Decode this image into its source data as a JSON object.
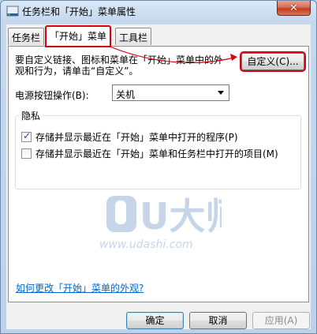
{
  "window": {
    "title": "任务栏和「开始」菜单属性",
    "close_glyph": "✕"
  },
  "tabs": [
    {
      "label": "任务栏",
      "active": false
    },
    {
      "label": "「开始」菜单",
      "active": true
    },
    {
      "label": "工具栏",
      "active": false
    }
  ],
  "start_menu": {
    "description": "要自定义链接、图标和菜单在「开始」菜单中的外观和行为，请单击“自定义”。",
    "customize_button": "自定义(C)...",
    "power_label": "电源按钮操作(B):",
    "power_value": "关机",
    "privacy": {
      "title": "隐私",
      "items": [
        {
          "label": "存储并显示最近在「开始」菜单中打开的程序(P)",
          "checked": true
        },
        {
          "label": "存储并显示最近在「开始」菜单和任务栏中打开的项目(M)",
          "checked": false
        }
      ]
    },
    "help_link": "如何更改「开始」菜单的外观?"
  },
  "watermark": {
    "logo_text": "U大师",
    "url": "www.udashi.com"
  },
  "buttons": {
    "ok": "确定",
    "cancel": "取消",
    "apply": "应用(A)"
  },
  "colors": {
    "highlight": "#d7000f",
    "link": "#0066cc",
    "watermark": "#c6d6e8"
  }
}
